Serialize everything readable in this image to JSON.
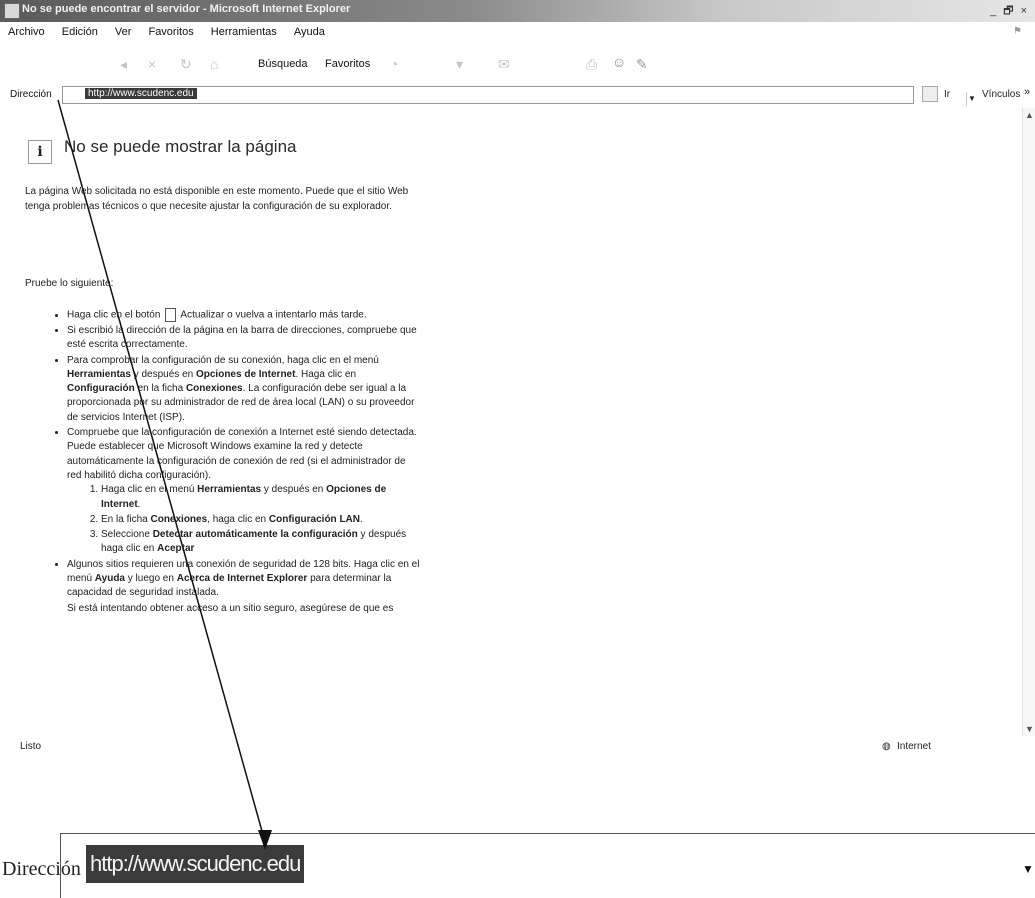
{
  "window": {
    "title": "No se puede encontrar el servidor - Microsoft Internet Explorer",
    "controls": "_ 🗗 ×"
  },
  "menu": [
    "Archivo",
    "Edición",
    "Ver",
    "Favoritos",
    "Herramientas",
    "Ayuda"
  ],
  "toolbar": {
    "search_label": "Búsqueda",
    "favorites_label": "Favoritos"
  },
  "address": {
    "label": "Dirección",
    "url": "http://www.scudenc.edu",
    "go_label": "Ir",
    "links_label": "Vínculos"
  },
  "content": {
    "heading": "No se puede mostrar la página",
    "intro": "La página Web solicitada no está disponible en este momento. Puede que el sitio Web tenga problemas técnicos o que necesite ajustar la configuración de su explorador.",
    "try_heading": "Pruebe lo siguiente:",
    "bullet1_a": "Haga clic en el botón",
    "bullet1_b": "Actualizar o vuelva a intentarlo más tarde.",
    "bullet2": "Si escribió la dirección de la página en la barra de direcciones, compruebe que esté escrita correctamente.",
    "bullet3_a": "Para comprobar la configuración de su conexión, haga clic en el menú",
    "bullet3_b": "Herramientas",
    "bullet3_c": "y después en",
    "bullet3_d": "Opciones de Internet",
    "bullet3_e": ". Haga clic en",
    "bullet3_f": "Configuración",
    "bullet3_g": "en la ficha",
    "bullet3_h": "Conexiones",
    "bullet3_i": ". La configuración debe ser igual a la proporcionada por su administrador de red de área local (LAN) o su proveedor de servicios Internet (ISP).",
    "bullet4": "Compruebe que la configuración de conexión a Internet esté siendo detectada. Puede establecer que Microsoft Windows examine la red y detecte automáticamente la configuración de conexión de red (si el administrador de red habilitó dicha configuración).",
    "step1_a": "Haga clic en el menú",
    "step1_b": "Herramientas",
    "step1_c": "y después en",
    "step1_d": "Opciones de Internet",
    "step2_a": "En la ficha",
    "step2_b": "Conexiones",
    "step2_c": ", haga clic en",
    "step2_d": "Configuración LAN",
    "step3_a": "Seleccione",
    "step3_b": "Detectar automáticamente la configuración",
    "step3_c": "y después haga clic en",
    "step3_d": "Aceptar",
    "bullet5_a": "Algunos sitios requieren una conexión de seguridad de 128 bits. Haga clic en el menú",
    "bullet5_b": "Ayuda",
    "bullet5_c": "y luego en",
    "bullet5_d": "Acerca de Internet Explorer",
    "bullet5_e": "para determinar la capacidad de seguridad instalada.",
    "bullet6": "Si está intentando obtener acceso a un sitio seguro, asegúrese de que es compatible con su configuración de"
  },
  "status": {
    "text": "Listo",
    "zone": "Internet"
  },
  "zoom": {
    "label": "Dirección",
    "url": "http://www.scudenc.edu"
  },
  "icons": [
    "ie-page-icon",
    "info-icon",
    "go-icon",
    "globe-icon",
    "dropdown-arrow-icon"
  ]
}
